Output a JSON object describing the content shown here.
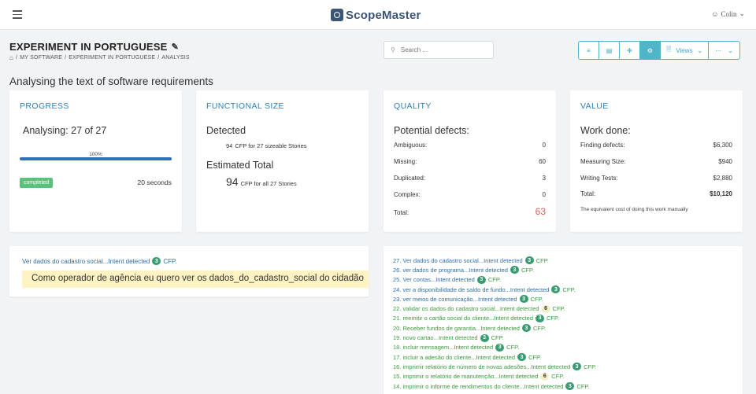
{
  "header": {
    "logo_text": "ScopeMaster",
    "user_name": "Colin"
  },
  "page": {
    "title": "EXPERIMENT IN PORTUGUESE",
    "breadcrumb": [
      "MY SOFTWARE",
      "EXPERIMENT IN PORTUGUESE",
      "ANALYSIS"
    ],
    "search_placeholder": "Search ...",
    "views_label": "Views",
    "subheading": "Analysing the text of software requirements"
  },
  "progress": {
    "title": "PROGRESS",
    "analysing": "Analysing: 27 of 27",
    "percent_label": "100%",
    "percent": 1.0,
    "status": "completed",
    "elapsed": "20 seconds"
  },
  "functional_size": {
    "title": "FUNCTIONAL SIZE",
    "detected_label": "Detected",
    "detected_value": "94",
    "detected_text": "CFP for 27  sizeable Stories",
    "estimated_label": "Estimated Total",
    "estimated_value": "94",
    "estimated_text": "CFP for all 27 Stories"
  },
  "quality": {
    "title": "QUALITY",
    "heading": "Potential defects:",
    "rows": [
      {
        "label": "Ambiguous:",
        "value": "0"
      },
      {
        "label": "Missing:",
        "value": "60"
      },
      {
        "label": "Duplicated:",
        "value": "3"
      },
      {
        "label": "Complex:",
        "value": "0"
      }
    ],
    "total_label": "Total:",
    "total_value": "63"
  },
  "value": {
    "title": "VALUE",
    "heading": "Work done:",
    "rows": [
      {
        "label": "Finding defects:",
        "value": "$6,300"
      },
      {
        "label": "Measuring Size:",
        "value": "$940"
      },
      {
        "label": "Writing Tests:",
        "value": "$2,880"
      }
    ],
    "total_label": "Total:",
    "total_value": "$10,120",
    "note": "The equivalent cost of doing this work manually"
  },
  "story_detail": {
    "link_text": "Ver dados do cadastro social...Intent detected",
    "badge": "3",
    "cfp": "CFP.",
    "quote": "Como operador de agência eu quero ver os dados_do_cadastro_social do cidadão"
  },
  "story_list": {
    "items": [
      {
        "text": "27. Ver dados do cadastro social...Intent detected",
        "badge": "3",
        "style": "link",
        "cfp": "CFP."
      },
      {
        "text": "26. ver dados de programa...Intent detected",
        "badge": "3",
        "style": "link",
        "cfp": "CFP."
      },
      {
        "text": "25. Ver contas...Intent detected",
        "badge": "3",
        "style": "link",
        "cfp": "CFP."
      },
      {
        "text": "24. ver a disponibilidade de saldo de fundo...Intent detected",
        "badge": "3",
        "style": "link",
        "cfp": "CFP."
      },
      {
        "text": "23. ver meios de comunicação...Intent detected",
        "badge": "3",
        "style": "link",
        "cfp": "CFP."
      },
      {
        "text": "22. validar os dados do cadastro social...Intent detected",
        "badge": "6",
        "style": "green",
        "cfp": "CFP."
      },
      {
        "text": "21. reemitir o cartão social do cliente...Intent detected",
        "badge": "3",
        "style": "green",
        "cfp": "CFP."
      },
      {
        "text": "20. Receber fundos de garantia...Intent detected",
        "badge": "3",
        "style": "green",
        "cfp": "CFP."
      },
      {
        "text": "19. novo cartao...Intent detected",
        "badge": "3",
        "style": "green",
        "cfp": "CFP."
      },
      {
        "text": "18. incluir mensagem...Intent detected",
        "badge": "3",
        "style": "green",
        "cfp": "CFP."
      },
      {
        "text": "17. incluir a adesão do cliente...Intent detected",
        "badge": "3",
        "style": "green",
        "cfp": "CFP."
      },
      {
        "text": "16. imprimir relatório de número de novas adesões...Intent detected",
        "badge": "3",
        "style": "green",
        "cfp": "CFP."
      },
      {
        "text": "15. imprimir o relatório de manutenção...Intent detected",
        "badge": "6",
        "style": "green",
        "cfp": "CFP."
      },
      {
        "text": "14. imprimir o informe de rendimentos do cliente...Intent detected",
        "badge": "3",
        "style": "green",
        "cfp": "CFP."
      }
    ]
  },
  "colors": {
    "accent": "#4fb5c9",
    "title_blue": "#2d7fb8",
    "link_blue": "#2d6fa8",
    "green_text": "#3a9a3a",
    "badge_green": "#3a9b73",
    "badge_completed": "#5cc07d",
    "defect_total": "#e65a5a",
    "highlight": "#fff3c4"
  }
}
